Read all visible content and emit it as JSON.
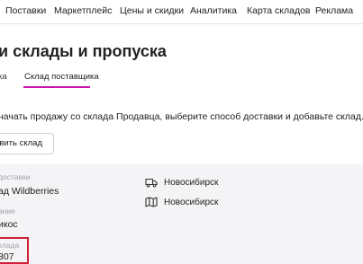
{
  "top_nav": {
    "items": [
      "Поставки",
      "Маркетплейс",
      "Цены и скидки",
      "Аналитика",
      "Карта складов",
      "Реклама"
    ]
  },
  "page": {
    "title": "и склады и пропуска"
  },
  "tabs": [
    {
      "label": "ка",
      "active": false
    },
    {
      "label": "Склад поставщика",
      "active": true
    }
  ],
  "info": {
    "text": "начать продажу со склада Продавца, выберите способ доставки и добавьте склад.",
    "add_button_label": "авить склад"
  },
  "warehouse": {
    "delivery_label": "доставки",
    "delivery_value": "ад Wildberries",
    "name_label": "ание",
    "name_value": "икос",
    "id_label": "клада",
    "id_value": "307",
    "city_delivery": "Новосибирск",
    "city_map": "Новосибирск"
  },
  "colors": {
    "accent": "#cb11ab",
    "highlight": "#d0213a",
    "panel_bg": "#f4f4f6"
  },
  "icons": {
    "delivery": "truck-icon",
    "map": "map-icon"
  }
}
